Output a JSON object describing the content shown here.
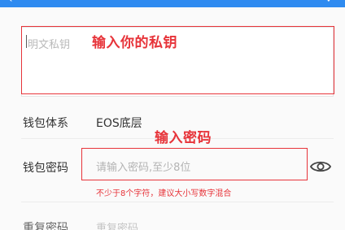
{
  "private_key": {
    "placeholder": "明文私钥"
  },
  "annotations": {
    "private_key": "输入你的私钥",
    "password": "输入密码"
  },
  "wallet_system": {
    "label": "钱包体系",
    "value": "EOS底层"
  },
  "wallet_password": {
    "label": "钱包密码",
    "placeholder": "请输入密码,至少8位",
    "hint": "不少于8个字符，建议大小写数字混合",
    "visibility_icon": "eye-icon"
  },
  "repeat_password": {
    "label": "重复密码",
    "placeholder": "重复密码"
  },
  "colors": {
    "accent": "#2f8bf0",
    "annotation_red": "#e7343a"
  }
}
